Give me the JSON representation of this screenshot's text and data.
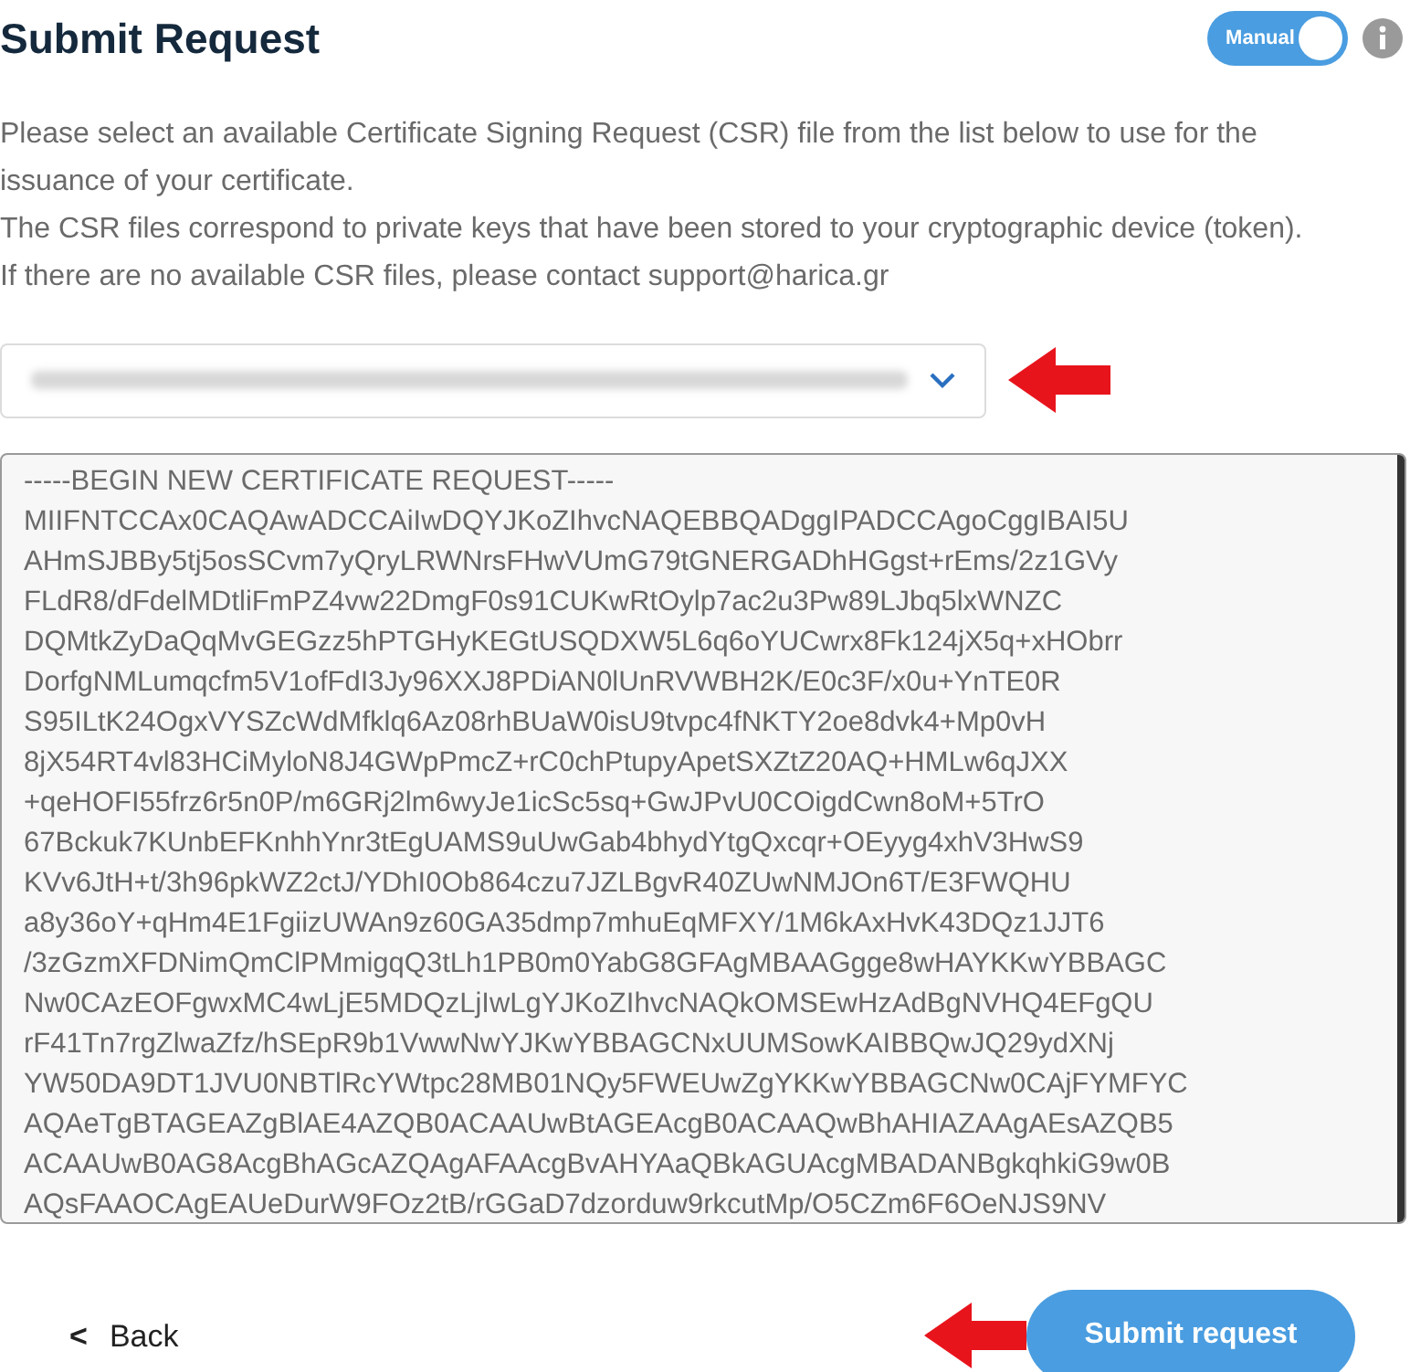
{
  "title": "Submit Request",
  "mode_toggle": {
    "label": "Manual",
    "on": true
  },
  "description": [
    "Please select an available Certificate Signing Request (CSR) file from the list below to use for the issuance of your certificate.",
    "The CSR files correspond to private keys that have been stored to your cryptographic device (token).",
    "If there are no available CSR files, please contact support@harica.gr"
  ],
  "csr_select": {
    "redacted": true
  },
  "csr_text": [
    "-----BEGIN NEW CERTIFICATE REQUEST-----",
    "MIIFNTCCAx0CAQAwADCCAiIwDQYJKoZIhvcNAQEBBQADggIPADCCAgoCggIBAI5U",
    "AHmSJBBy5tj5osSCvm7yQryLRWNrsFHwVUmG79tGNERGADhHGgst+rEms/2z1GVy",
    "FLdR8/dFdelMDtliFmPZ4vw22DmgF0s91CUKwRtOylp7ac2u3Pw89LJbq5lxWNZC",
    "DQMtkZyDaQqMvGEGzz5hPTGHyKEGtUSQDXW5L6q6oYUCwrx8Fk124jX5q+xHObrr",
    "DorfgNMLumqcfm5V1ofFdI3Jy96XXJ8PDiAN0lUnRVWBH2K/E0c3F/x0u+YnTE0R",
    "S95ILtK24OgxVYSZcWdMfklq6Az08rhBUaW0isU9tvpc4fNKTY2oe8dvk4+Mp0vH",
    "8jX54RT4vl83HCiMyloN8J4GWpPmcZ+rC0chPtupyApetSXZtZ20AQ+HMLw6qJXX",
    "+qeHOFI55frz6r5n0P/m6GRj2lm6wyJe1icSc5sq+GwJPvU0COigdCwn8oM+5TrO",
    "67Bckuk7KUnbEFKnhhYnr3tEgUAMS9uUwGab4bhydYtgQxcqr+OEyyg4xhV3HwS9",
    "KVv6JtH+t/3h96pkWZ2ctJ/YDhI0Ob864czu7JZLBgvR40ZUwNMJOn6T/E3FWQHU",
    "a8y36oY+qHm4E1FgiizUWAn9z60GA35dmp7mhuEqMFXY/1M6kAxHvK43DQz1JJT6",
    "/3zGzmXFDNimQmClPMmigqQ3tLh1PB0m0YabG8GFAgMBAAGgge8wHAYKKwYBBAGC",
    "Nw0CAzEOFgwxMC4wLjE5MDQzLjIwLgYJKoZIhvcNAQkOMSEwHzAdBgNVHQ4EFgQU",
    "rF41Tn7rgZlwaZfz/hSEpR9b1VwwNwYJKwYBBAGCNxUUMSowKAIBBQwJQ29ydXNj",
    "YW50DA9DT1JVU0NBTlRcYWtpc28MB01NQy5FWEUwZgYKKwYBBAGCNw0CAjFYMFYC",
    "AQAeTgBTAGEAZgBlAE4AZQB0ACAAUwBtAGEAcgB0ACAAQwBhAHIAZAAgAEsAZQB5",
    "ACAAUwB0AG8AcgBhAGcAZQAgAFAAcgBvAHYAaQBkAGUAcgMBADANBgkqhkiG9w0B",
    "AQsFAAOCAgEAUeDurW9FOz2tB/rGGaD7dzorduw9rkcutMp/O5CZm6F6OeNJS9NV"
  ],
  "back_link": {
    "icon": "<",
    "label": "Back"
  },
  "submit_button": {
    "label": "Submit request"
  },
  "annotations": [
    {
      "kind": "arrow"
    },
    {
      "kind": "arrow"
    }
  ]
}
